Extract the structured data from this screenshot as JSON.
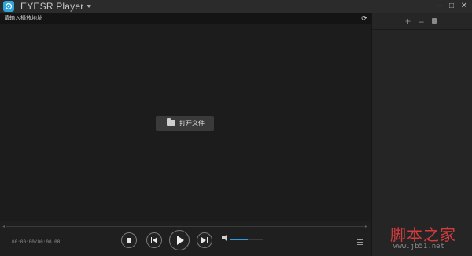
{
  "titlebar": {
    "app_title": "EYESR Player",
    "minimize_label": "–",
    "maximize_label": "□",
    "close_label": "✕"
  },
  "address": {
    "placeholder": "请输入播放地址",
    "refresh_icon": "⟳"
  },
  "main": {
    "open_file_label": "打开文件"
  },
  "controls": {
    "time": "00:00:00/00:00:00",
    "volume_level": 0.55
  },
  "sidebar": {
    "add_icon": "+",
    "remove_icon": "–"
  },
  "watermark": {
    "text": "脚本之家",
    "url": "www.jb51.net"
  },
  "colors": {
    "accent": "#2f9be3",
    "watermark_red": "#d23c3c"
  }
}
